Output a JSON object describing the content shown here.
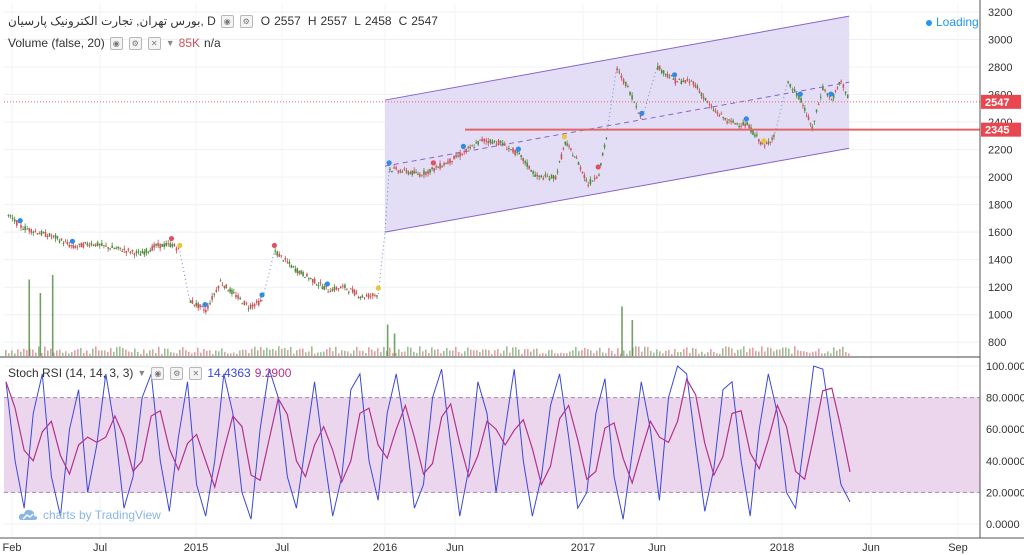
{
  "legend_main": {
    "symbol": "بورس تهران, تجارت الکترونیک پارسیان, D",
    "open_label": "O",
    "open": "2557",
    "high_label": "H",
    "high": "2557",
    "low_label": "L",
    "low": "2458",
    "close_label": "C",
    "close": "2547"
  },
  "legend_volume": {
    "name": "Volume (false, 20)",
    "value": "85K",
    "extra": "n/a"
  },
  "legend_rsi": {
    "name": "Stoch RSI (14, 14, 3, 3)",
    "k": "14.4363",
    "d": "9.2900"
  },
  "loading_text": "Loading",
  "watermark": "charts by TradingView",
  "colors": {
    "channel_fill": "#ded8f5",
    "channel_line": "#8a64c8",
    "rsi_band": "#ecd6ee",
    "rsi_k": "#3b48d8",
    "rsi_d": "#b0338c",
    "price_line": "#e06666",
    "level_line": "#e06666",
    "up": "#4e8a3c",
    "down": "#c9535a"
  },
  "chart_data": [
    {
      "type": "candlestick",
      "x_ticks": [
        "Feb",
        "Jul",
        "2015",
        "Jul",
        "2016",
        "Jun",
        "2017",
        "Jun",
        "2018",
        "Jun",
        "Sep"
      ],
      "y_ticks": [
        800,
        1000,
        1200,
        1400,
        1600,
        1800,
        2000,
        2200,
        2400,
        2600,
        2800,
        3000,
        3200
      ],
      "ylim": [
        700,
        3200
      ],
      "price_labels": [
        "2547",
        "2345"
      ],
      "last_price": 2547,
      "horizontal_level": 2345,
      "price_path": [
        [
          "2014-01-15",
          1720
        ],
        [
          "2014-02-15",
          1640
        ],
        [
          "2014-03-15",
          1600
        ],
        [
          "2014-04-15",
          1560
        ],
        [
          "2014-05-15",
          1490
        ],
        [
          "2014-06-15",
          1520
        ],
        [
          "2014-07-15",
          1490
        ],
        [
          "2014-08-15",
          1470
        ],
        [
          "2014-09-15",
          1440
        ],
        [
          "2014-10-15",
          1500
        ],
        [
          "2014-11-15",
          1510
        ],
        [
          "2014-12-01",
          1460
        ],
        [
          "2014-12-20",
          1100
        ],
        [
          "2015-01-20",
          1030
        ],
        [
          "2015-02-20",
          1240
        ],
        [
          "2015-03-20",
          1150
        ],
        [
          "2015-04-20",
          1060
        ],
        [
          "2015-05-20",
          1100
        ],
        [
          "2015-06-15",
          1460
        ],
        [
          "2015-07-20",
          1340
        ],
        [
          "2015-08-20",
          1260
        ],
        [
          "2015-09-20",
          1180
        ],
        [
          "2015-10-20",
          1200
        ],
        [
          "2015-11-20",
          1130
        ],
        [
          "2015-12-20",
          1150
        ],
        [
          "2016-01-01",
          1600
        ],
        [
          "2016-01-10",
          2060
        ],
        [
          "2016-02-15",
          2040
        ],
        [
          "2016-03-15",
          2020
        ],
        [
          "2016-04-15",
          2060
        ],
        [
          "2016-05-15",
          2110
        ],
        [
          "2016-06-15",
          2180
        ],
        [
          "2016-07-15",
          2270
        ],
        [
          "2016-08-15",
          2250
        ],
        [
          "2016-09-15",
          2160
        ],
        [
          "2016-10-15",
          2000
        ],
        [
          "2016-11-15",
          2000
        ],
        [
          "2016-12-01",
          2250
        ],
        [
          "2016-12-20",
          2130
        ],
        [
          "2017-01-10",
          1950
        ],
        [
          "2017-02-01",
          2030
        ],
        [
          "2017-02-20",
          2350
        ],
        [
          "2017-03-10",
          2780
        ],
        [
          "2017-04-01",
          2650
        ],
        [
          "2017-05-01",
          2420
        ],
        [
          "2017-06-01",
          2800
        ],
        [
          "2017-07-01",
          2700
        ],
        [
          "2017-08-01",
          2690
        ],
        [
          "2017-09-01",
          2500
        ],
        [
          "2017-10-01",
          2400
        ],
        [
          "2017-11-01",
          2380
        ],
        [
          "2017-12-01",
          2220
        ],
        [
          "2017-12-20",
          2320
        ],
        [
          "2018-01-10",
          2680
        ],
        [
          "2018-02-01",
          2560
        ],
        [
          "2018-02-20",
          2350
        ],
        [
          "2018-03-10",
          2650
        ],
        [
          "2018-03-25",
          2560
        ],
        [
          "2018-04-10",
          2700
        ],
        [
          "2018-04-25",
          2547
        ]
      ],
      "channel": {
        "upper": [
          [
            "2016-01-01",
            2560
          ],
          [
            "2018-04-25",
            3170
          ]
        ],
        "lower": [
          [
            "2016-01-01",
            1600
          ],
          [
            "2018-04-25",
            2210
          ]
        ],
        "mid": [
          [
            "2016-01-01",
            2080
          ],
          [
            "2018-04-25",
            2690
          ]
        ]
      },
      "volume_spikes": [
        [
          "2014-03-01",
          0.85
        ],
        [
          "2014-03-20",
          0.7
        ],
        [
          "2014-04-10",
          0.9
        ],
        [
          "2016-01-05",
          0.35
        ],
        [
          "2016-01-20",
          0.25
        ],
        [
          "2017-03-20",
          0.55
        ],
        [
          "2017-04-10",
          0.4
        ]
      ]
    },
    {
      "type": "line",
      "name": "Stoch RSI (14, 14, 3, 3)",
      "y_ticks": [
        "0.0000",
        "20.0000",
        "40.0000",
        "60.0000",
        "80.0000",
        "100.0000"
      ],
      "ylim": [
        0,
        100
      ],
      "band": [
        20,
        80
      ],
      "k_last": 14.4363,
      "d_last": 9.29,
      "k_values": [
        90,
        40,
        10,
        70,
        95,
        30,
        5,
        60,
        85,
        20,
        50,
        95,
        60,
        10,
        30,
        80,
        95,
        40,
        8,
        55,
        90,
        25,
        5,
        40,
        95,
        70,
        20,
        3,
        60,
        98,
        80,
        30,
        10,
        50,
        90,
        45,
        5,
        30,
        85,
        95,
        40,
        15,
        70,
        95,
        60,
        10,
        25,
        80,
        98,
        50,
        5,
        35,
        90,
        70,
        20,
        60,
        98,
        40,
        5,
        30,
        75,
        95,
        55,
        10,
        20,
        70,
        92,
        30,
        3,
        45,
        90,
        60,
        15,
        80,
        100,
        95,
        50,
        8,
        35,
        85,
        90,
        40,
        5,
        60,
        95,
        70,
        20,
        10,
        55,
        100,
        98,
        60,
        25,
        14
      ]
    }
  ]
}
